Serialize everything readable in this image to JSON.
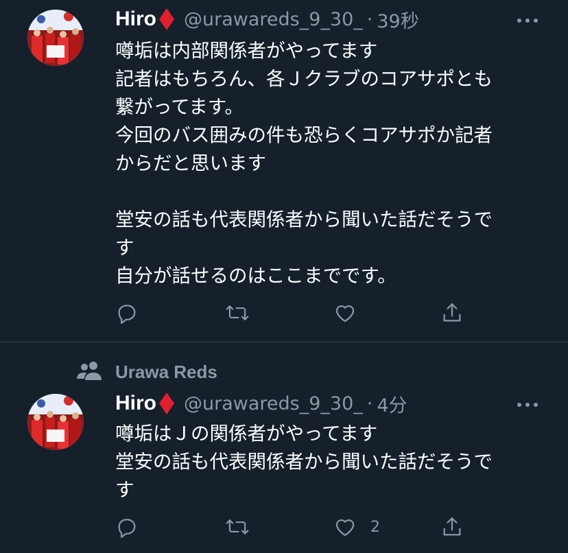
{
  "colors": {
    "background": "#15202b",
    "secondary_text": "#8b98a5",
    "divider": "#38444d",
    "diamond": "#e0202e"
  },
  "tweets": [
    {
      "name": "Hiro",
      "handle": "@urawareds_9_30_",
      "separator": "·",
      "time": "39秒",
      "text": "噂垢は内部関係者がやってます\n記者はもちろん、各Ｊクラブのコアサポとも\n繋がってます。\n今回のバス囲みの件も恐らくコアサポか記者\nからだと思います\n\n堂安の話も代表関係者から聞いた話だそうで\nす\n自分が話せるのはここまでです。",
      "like_count": ""
    },
    {
      "name": "Hiro",
      "handle": "@urawareds_9_30_",
      "separator": "·",
      "time": "4分",
      "text": "噂垢はＪの関係者がやってます\n堂安の話も代表関係者から聞いた話だそうで\nす",
      "like_count": "2"
    }
  ],
  "context": {
    "icon": "users-icon",
    "label": "Urawa Reds"
  },
  "icons": [
    "reply-icon",
    "retweet-icon",
    "like-icon",
    "share-icon",
    "more-icon",
    "diamond-icon"
  ]
}
